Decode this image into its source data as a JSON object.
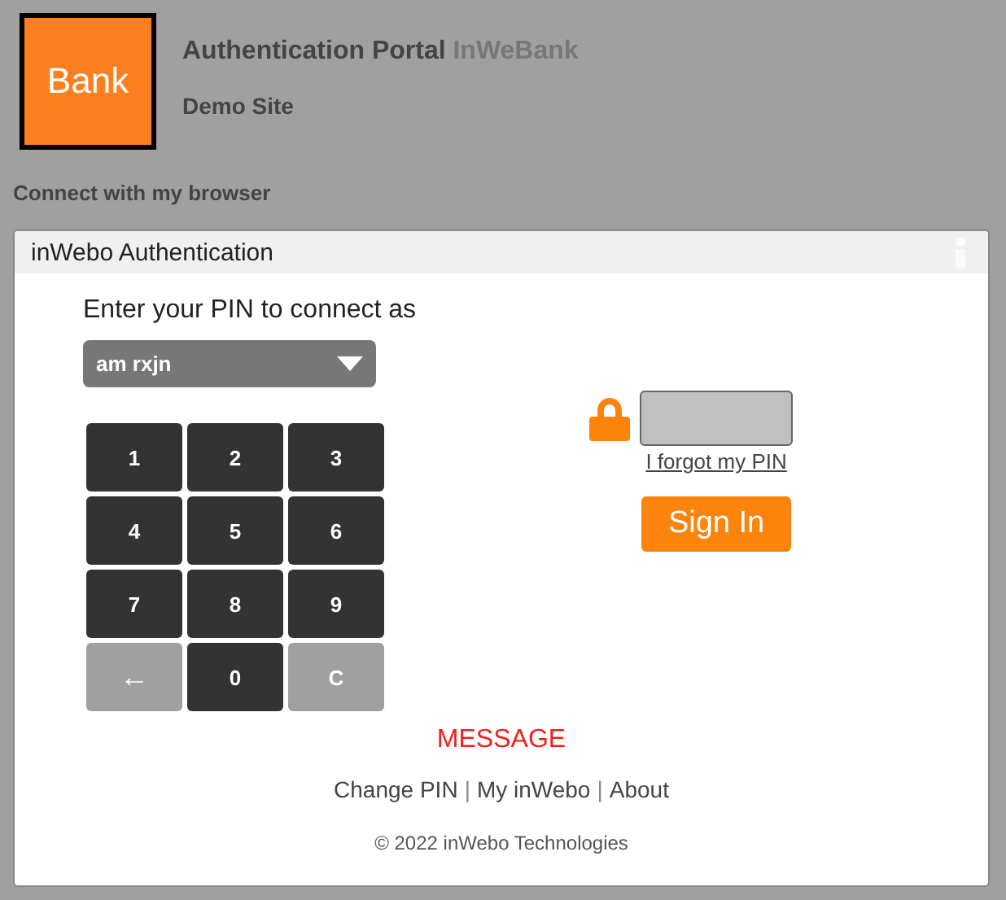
{
  "logo": {
    "text": "Bank"
  },
  "header": {
    "title": "Authentication Portal",
    "brand": "InWeBank",
    "subtitle": "Demo Site"
  },
  "section_label": "Connect with my browser",
  "panel": {
    "title": "inWebo Authentication",
    "prompt": "Enter your PIN to connect as",
    "account": "am rxjn",
    "keys": [
      {
        "label": "1",
        "disabled": false
      },
      {
        "label": "2",
        "disabled": false
      },
      {
        "label": "3",
        "disabled": false
      },
      {
        "label": "4",
        "disabled": false
      },
      {
        "label": "5",
        "disabled": false
      },
      {
        "label": "6",
        "disabled": false
      },
      {
        "label": "7",
        "disabled": false
      },
      {
        "label": "8",
        "disabled": false
      },
      {
        "label": "9",
        "disabled": false
      },
      {
        "label": "←",
        "disabled": true
      },
      {
        "label": "0",
        "disabled": false
      },
      {
        "label": "C",
        "disabled": true
      }
    ],
    "forgot_link": "I forgot my PIN",
    "sign_in": "Sign In",
    "message": "MESSAGE",
    "links": [
      "Change PIN",
      "My inWebo",
      "About"
    ],
    "separator": "|",
    "copyright": "© 2022 inWebo Technologies"
  }
}
